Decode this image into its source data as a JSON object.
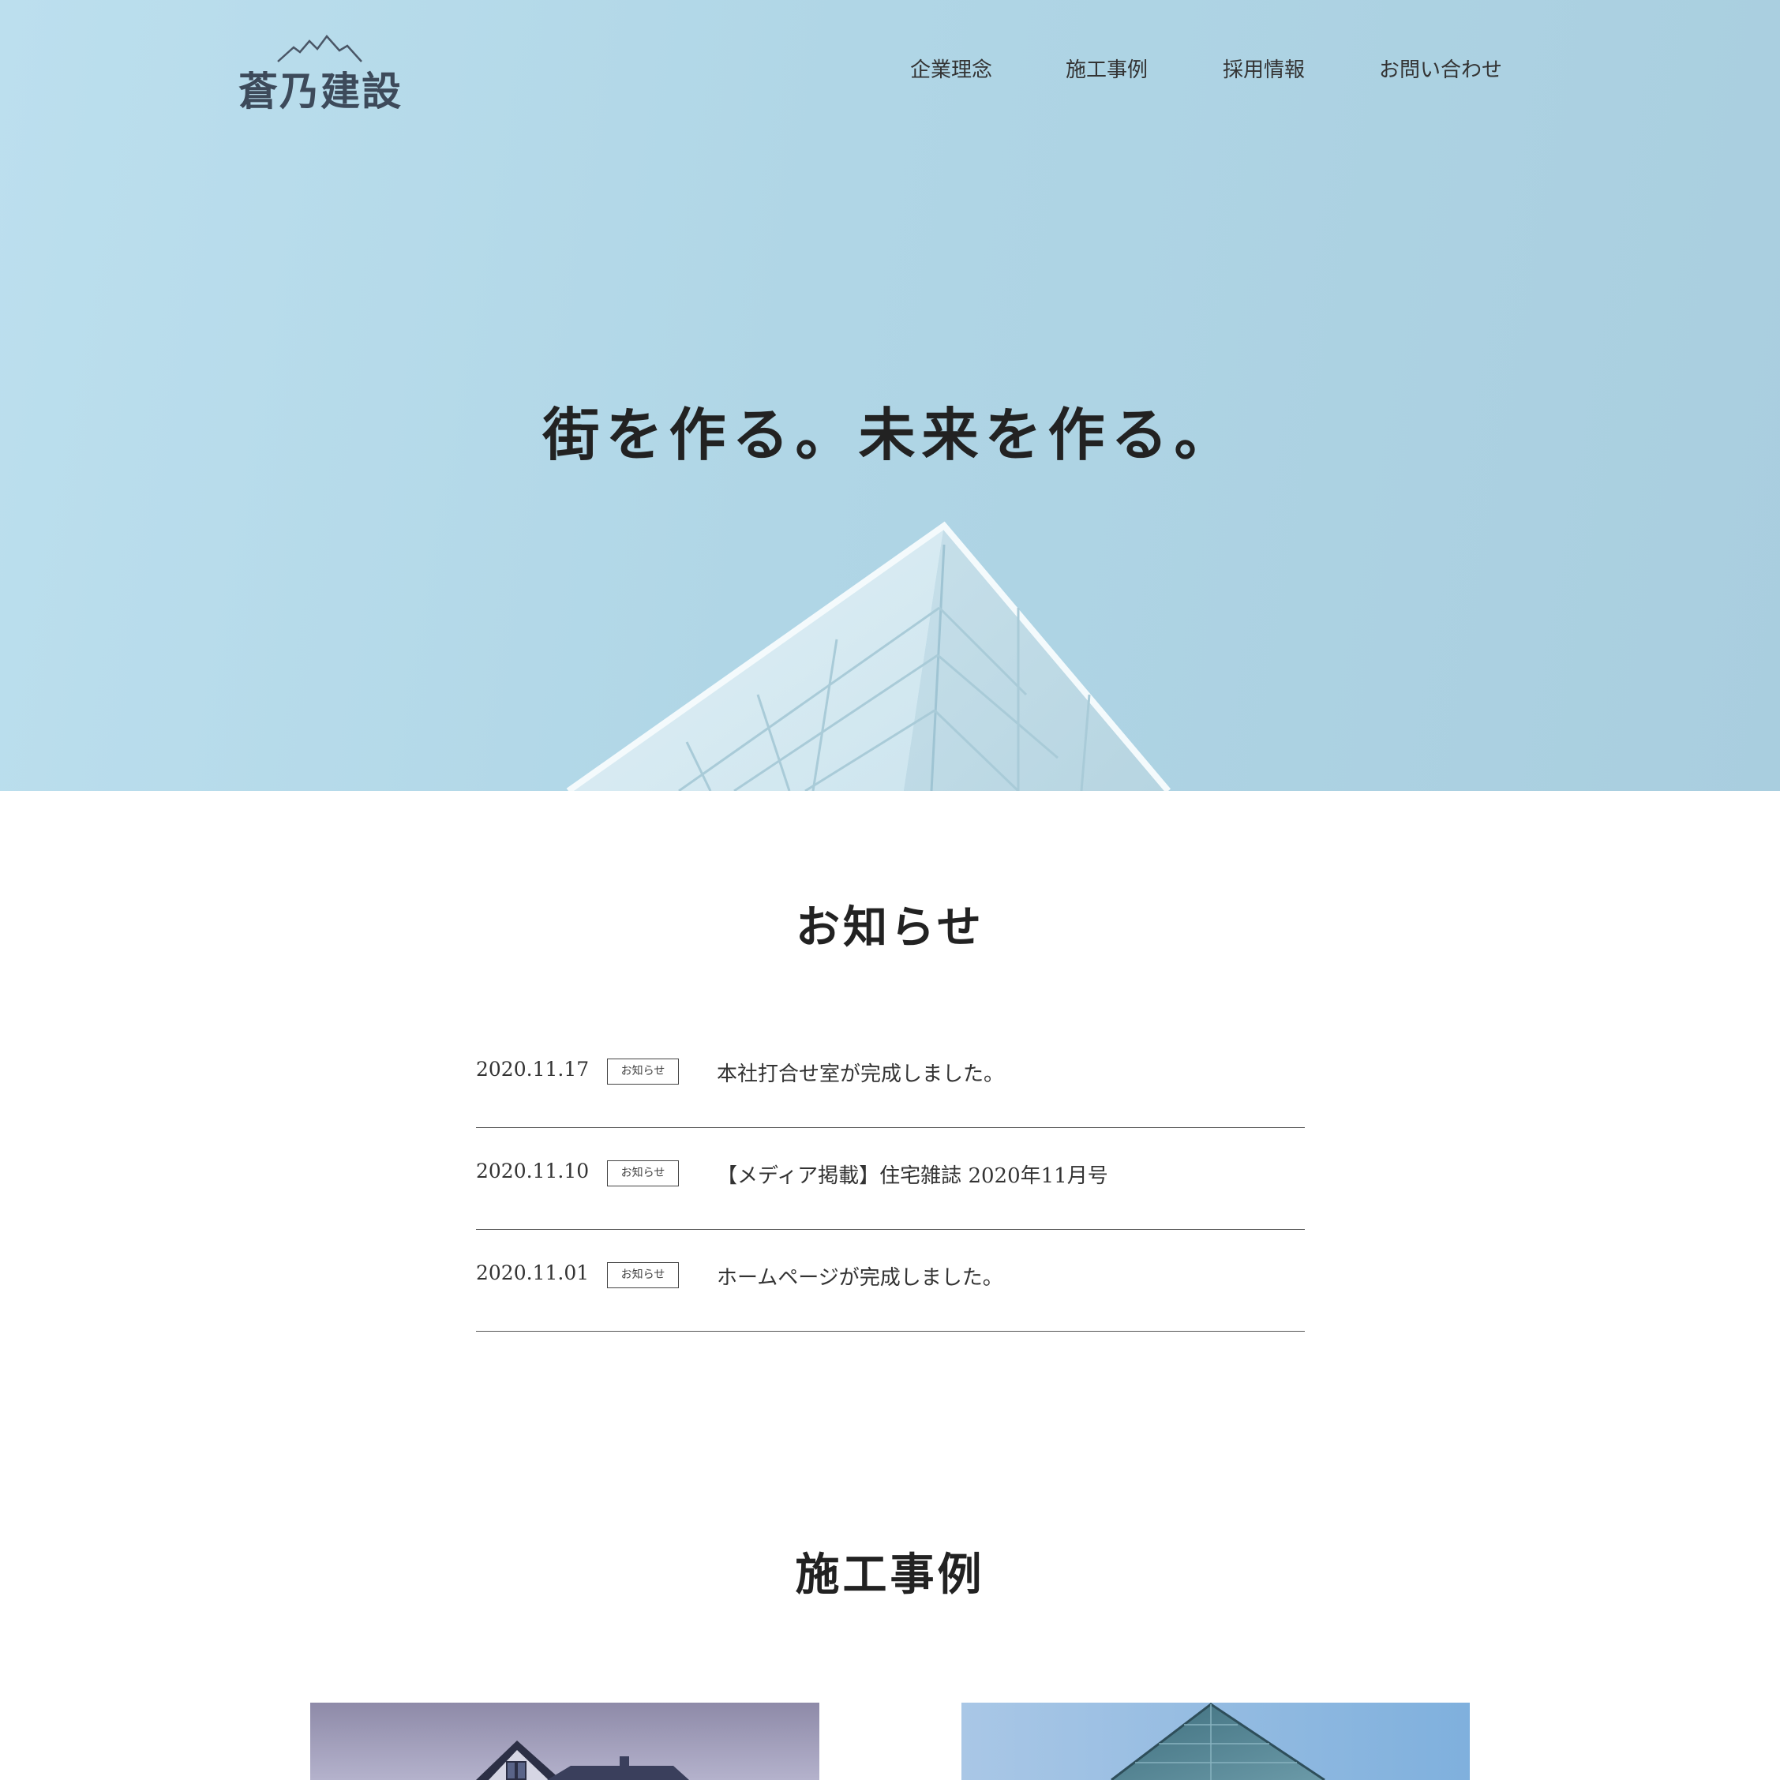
{
  "brand": {
    "logo_text": "蒼乃建設"
  },
  "nav": {
    "items": [
      {
        "label": "企業理念"
      },
      {
        "label": "施工事例"
      },
      {
        "label": "採用情報"
      },
      {
        "label": "お問い合わせ"
      }
    ]
  },
  "hero": {
    "title": "街を作る。未来を作る。"
  },
  "news": {
    "title": "お知らせ",
    "items": [
      {
        "date": "2020.11.17",
        "category": "お知らせ",
        "text": "本社打合せ室が完成しました。"
      },
      {
        "date": "2020.11.10",
        "category": "お知らせ",
        "text": "【メディア掲載】住宅雑誌 2020年11月号"
      },
      {
        "date": "2020.11.01",
        "category": "お知らせ",
        "text": "ホームページが完成しました。"
      }
    ]
  },
  "works": {
    "title": "施工事例"
  },
  "colors": {
    "hero_sky": "#b0d6e6",
    "text": "#333333",
    "logo": "#3d4a5a",
    "rule": "#555555"
  }
}
